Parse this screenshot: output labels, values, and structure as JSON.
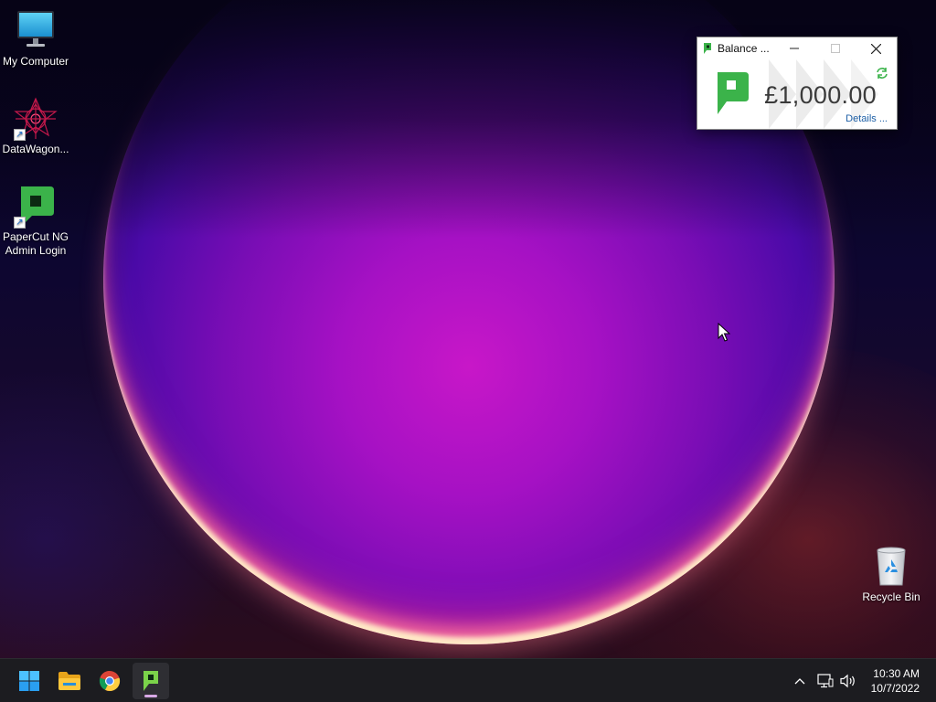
{
  "desktop": {
    "icons": [
      {
        "label": "My Computer",
        "icon": "monitor-icon"
      },
      {
        "label": "DataWagon...",
        "icon": "datawagon-icon",
        "shortcut": true
      },
      {
        "label": "PaperCut NG Admin Login",
        "icon": "papercut-icon",
        "shortcut": true
      },
      {
        "label": "Recycle Bin",
        "icon": "recycle-bin-icon"
      }
    ]
  },
  "balance_window": {
    "title": "Balance ...",
    "amount": "£1,000.00",
    "details_link": "Details ...",
    "accent_color": "#3bb34a"
  },
  "taskbar": {
    "items": [
      {
        "name": "start",
        "icon": "windows-start-icon"
      },
      {
        "name": "file-explorer",
        "icon": "folder-icon"
      },
      {
        "name": "chrome",
        "icon": "chrome-icon"
      },
      {
        "name": "papercut-client",
        "icon": "papercut-icon",
        "active": true
      }
    ],
    "tray": {
      "icons": [
        "chevron-up-icon",
        "network-icon",
        "volume-icon"
      ],
      "time": "10:30 AM",
      "date": "10/7/2022"
    }
  }
}
